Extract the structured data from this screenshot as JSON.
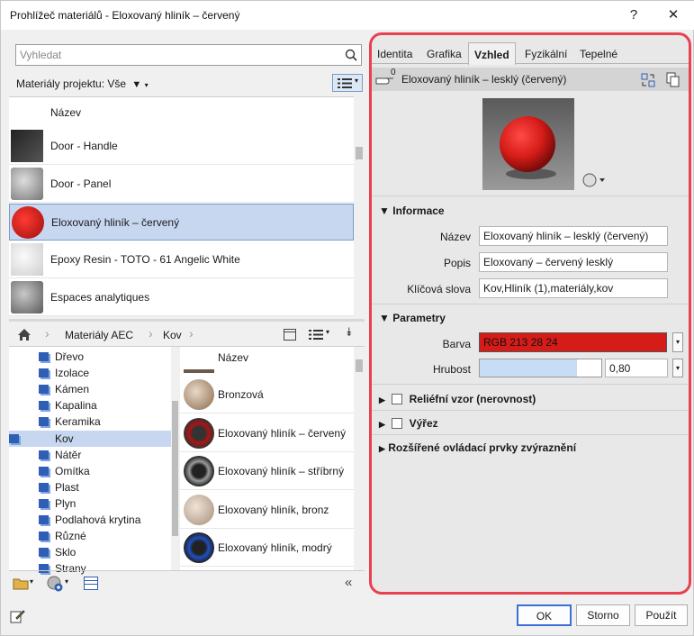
{
  "window": {
    "title": "Prohlížeč materiálů - Eloxovaný hliník – červený",
    "help": "?",
    "close": "✕"
  },
  "left": {
    "search_placeholder": "Vyhledat",
    "project_filter": "Materiály projektu: Vše",
    "list_header": "Název",
    "project_materials": [
      {
        "label": "Door - Handle"
      },
      {
        "label": "Door - Panel"
      },
      {
        "label": "Eloxovaný hliník – červený",
        "selected": true
      },
      {
        "label": "Epoxy Resin - TOTO - 61 Angelic White"
      },
      {
        "label": "Espaces analytiques"
      }
    ],
    "breadcrumb": [
      "Materiály AEC",
      "Kov"
    ],
    "tree": [
      {
        "label": "Dřevo"
      },
      {
        "label": "Izolace"
      },
      {
        "label": "Kámen"
      },
      {
        "label": "Kapalina"
      },
      {
        "label": "Keramika"
      },
      {
        "label": "Kov",
        "selected": true
      },
      {
        "label": "Nátěr"
      },
      {
        "label": "Omítka"
      },
      {
        "label": "Plast"
      },
      {
        "label": "Plyn"
      },
      {
        "label": "Podlahová krytina"
      },
      {
        "label": "Různé"
      },
      {
        "label": "Sklo"
      },
      {
        "label": "Strany"
      }
    ],
    "library_header": "Název",
    "library": [
      {
        "label": "Bronzová"
      },
      {
        "label": "Eloxovaný hliník – červený"
      },
      {
        "label": "Eloxovaný hliník – stříbrný"
      },
      {
        "label": "Eloxovaný hliník, bronz"
      },
      {
        "label": "Eloxovaný hliník, modrý"
      }
    ]
  },
  "right": {
    "tabs": [
      "Identita",
      "Grafika",
      "Vzhled",
      "Fyzikální",
      "Tepelné"
    ],
    "active_tab": "Vzhled",
    "asset_count": "0",
    "asset_name": "Eloxovaný hliník – lesklý (červený)",
    "info": {
      "heading": "Informace",
      "name_label": "Název",
      "name_value": "Eloxovaný hliník – lesklý (červený)",
      "desc_label": "Popis",
      "desc_value": "Eloxovaný – červený lesklý",
      "kw_label": "Klíčová slova",
      "kw_value": "Kov,Hliník (1),materiály,kov"
    },
    "params": {
      "heading": "Parametry",
      "color_label": "Barva",
      "color_value": "RGB 213 28 24",
      "color_hex": "#d51c18",
      "gloss_label": "Hrubost",
      "gloss_value": "0,80",
      "gloss_level": 0.8
    },
    "relief": "Reliéfní vzor (nerovnost)",
    "cutout": "Výřez",
    "advanced": "Rozšířené ovládací prvky zvýraznění"
  },
  "buttons": {
    "ok": "OK",
    "cancel": "Storno",
    "apply": "Použít"
  },
  "colors": {
    "accent": "#e8414f",
    "selection": "#c7d7ef",
    "tree_icon": "#2f5fb4"
  }
}
